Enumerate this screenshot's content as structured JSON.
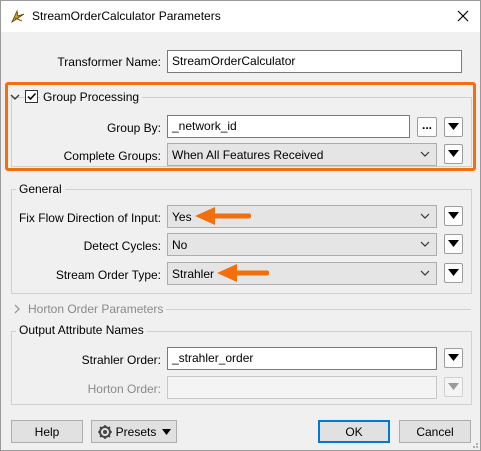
{
  "window": {
    "title": "StreamOrderCalculator Parameters"
  },
  "transformer": {
    "label": "Transformer Name:",
    "value": "StreamOrderCalculator"
  },
  "group_processing": {
    "label": "Group Processing",
    "checked": true,
    "group_by_label": "Group By:",
    "group_by_value": "_network_id",
    "dots_label": "...",
    "complete_groups_label": "Complete Groups:",
    "complete_groups_value": "When All Features Received"
  },
  "general": {
    "title": "General",
    "fix_flow_label": "Fix Flow Direction of Input:",
    "fix_flow_value": "Yes",
    "detect_cycles_label": "Detect Cycles:",
    "detect_cycles_value": "No",
    "stream_order_type_label": "Stream Order Type:",
    "stream_order_type_value": "Strahler"
  },
  "horton": {
    "title": "Horton Order Parameters"
  },
  "output": {
    "title": "Output Attribute Names",
    "strahler_label": "Strahler Order:",
    "strahler_value": "_strahler_order",
    "horton_label": "Horton Order:",
    "horton_value": ""
  },
  "buttons": {
    "help": "Help",
    "presets": "Presets",
    "ok": "OK",
    "cancel": "Cancel"
  },
  "colors": {
    "highlight": "#f26f0e",
    "accent": "#0078d7"
  }
}
